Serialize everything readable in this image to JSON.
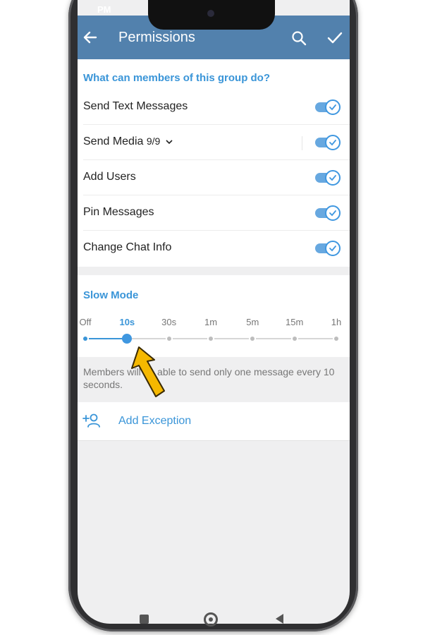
{
  "status_bar": {
    "left_text": "PM",
    "right_text": ""
  },
  "appbar": {
    "title": "Permissions",
    "back_icon": "arrow-left-icon",
    "search_icon": "search-icon",
    "confirm_icon": "check-icon"
  },
  "permissions": {
    "header": "What can members of this group do?",
    "items": [
      {
        "label": "Send Text Messages",
        "enabled": true
      },
      {
        "label": "Send Media",
        "count": "9/9",
        "enabled": true
      },
      {
        "label": "Add Users",
        "enabled": true
      },
      {
        "label": "Pin Messages",
        "enabled": true
      },
      {
        "label": "Change Chat Info",
        "enabled": true
      }
    ]
  },
  "slow_mode": {
    "header": "Slow Mode",
    "options": [
      "Off",
      "10s",
      "30s",
      "1m",
      "5m",
      "15m",
      "1h"
    ],
    "selected": "10s",
    "description": "Members will be able to send only one message every 10 seconds."
  },
  "add_exception": {
    "label": "Add Exception",
    "icon": "add-user-icon"
  },
  "navigation": {
    "icons": [
      "recent-apps-icon",
      "home-icon",
      "back-triangle-icon"
    ]
  },
  "colors": {
    "accent": "#3a95d8",
    "appbar": "#5281ad",
    "toggle_on": "#3f97e0",
    "annotation_arrow": "#f5b800"
  }
}
